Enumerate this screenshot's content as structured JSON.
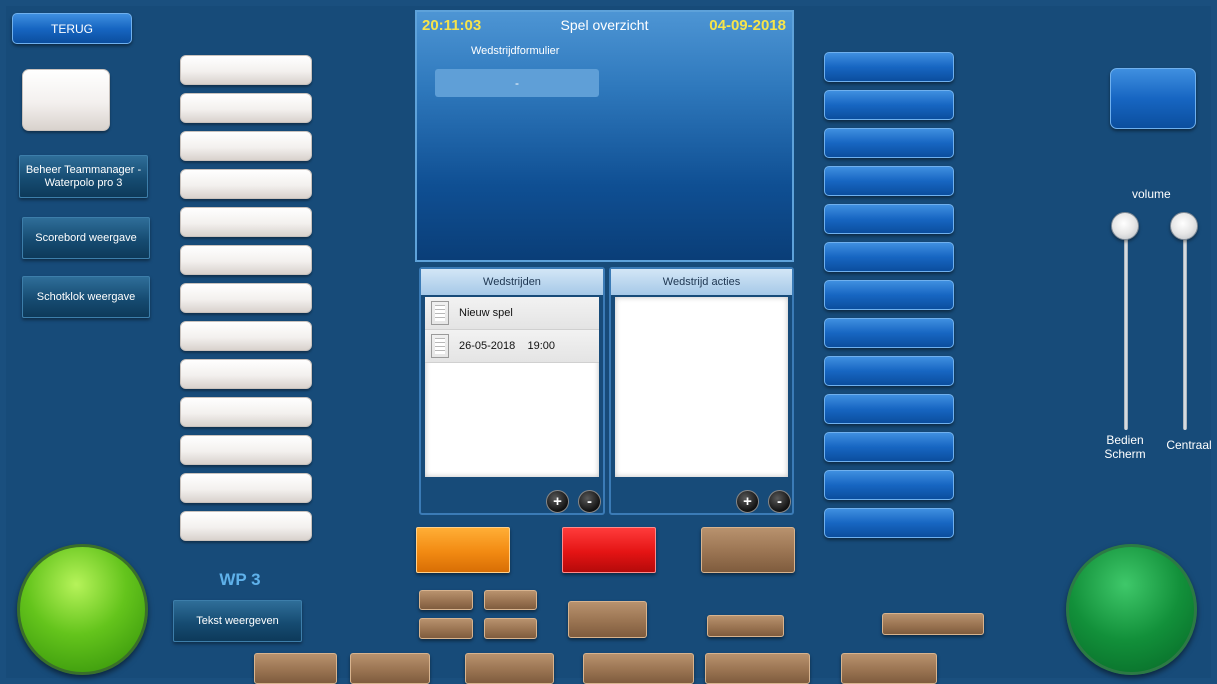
{
  "top_left": {
    "back_label": "TERUG"
  },
  "left_menu": {
    "items": [
      {
        "label": "Beheer Teammanager -\nWaterpolo pro 3"
      },
      {
        "label": "Scorebord  weergave"
      },
      {
        "label": "Schotklok weergave"
      }
    ]
  },
  "header": {
    "time": "20:11:03",
    "title": "Spel overzicht",
    "date": "04-09-2018",
    "subtitle": "Wedstrijdformulier",
    "field_value": "-"
  },
  "matches_panel": {
    "title": "Wedstrijden",
    "rows": [
      {
        "text": "Nieuw spel"
      },
      {
        "text": "26-05-2018    19:00"
      }
    ],
    "add_symbol": "+",
    "remove_symbol": "-"
  },
  "actions_panel": {
    "title": "Wedstrijd acties",
    "add_symbol": "+",
    "remove_symbol": "-"
  },
  "footer": {
    "team_label": "WP 3",
    "show_text_label": "Tekst weergeven"
  },
  "volume": {
    "label": "volume",
    "left_slider_label": "Bedien\nScherm",
    "right_slider_label": "Centraal",
    "left_level": 1.0,
    "right_level": 1.0
  },
  "colors": {
    "background": "#174b79",
    "accent_blue": "#1766c2",
    "brown_button": "#9a7452",
    "orange_button": "#f28a12",
    "red_button": "#e41414",
    "time_date_yellow": "#f6e44a",
    "green_light": "#64c41c",
    "green_dark": "#12903a"
  }
}
